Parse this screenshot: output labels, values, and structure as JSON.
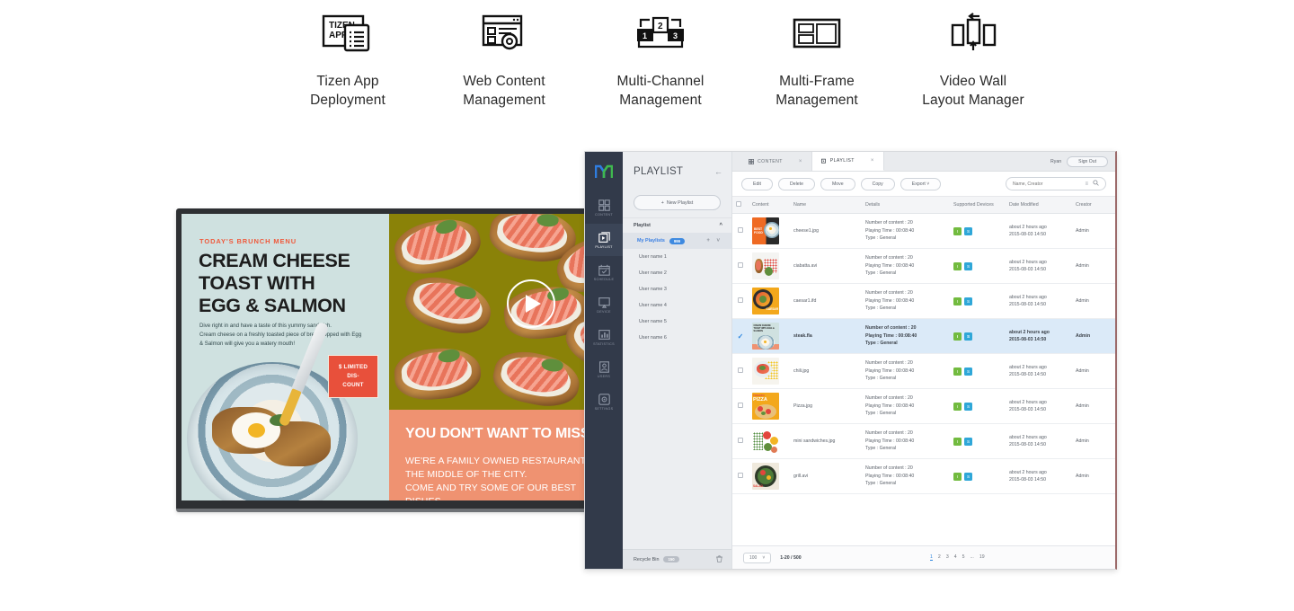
{
  "features": [
    {
      "icon": "tizen-app-icon",
      "label_line1": "Tizen App",
      "label_line2": "Deployment"
    },
    {
      "icon": "web-content-icon",
      "label_line1": "Web Content",
      "label_line2": "Management"
    },
    {
      "icon": "multi-channel-icon",
      "label_line1": "Multi-Channel",
      "label_line2": "Management"
    },
    {
      "icon": "multi-frame-icon",
      "label_line1": "Multi-Frame",
      "label_line2": "Management"
    },
    {
      "icon": "video-wall-icon",
      "label_line1": "Video Wall",
      "label_line2": "Layout Manager"
    }
  ],
  "display": {
    "kicker": "TODAY'S BRUNCH MENU",
    "title_line1": "CREAM CHEESE",
    "title_line2": "TOAST WITH",
    "title_line3": "EGG & SALMON",
    "body_line1": "Dive right in and have a taste of this yummy sandwich.",
    "body_line2": "Cream cheese on a freshly toasted piece of bread topped with Egg",
    "body_line3": "& Salmon will give you a watery mouth!",
    "discount_line1": "$ LIMITED",
    "discount_line2": "DIS-",
    "discount_line3": "COUNT",
    "promo_heading": "YOU DON'T WANT TO MISS",
    "promo_line1": "WE'RE A FAMILY OWNED RESTAURANT IN",
    "promo_line2": "THE MIDDLE OF THE CITY.",
    "promo_line3": "COME AND TRY SOME OF OUR BEST DISHES",
    "play_icon": "play-icon",
    "colors": {
      "menu_bg": "#cfe1e0",
      "accent": "#ef5a3c",
      "promo_bg": "#ef9271",
      "photo_bg": "#8a8208"
    }
  },
  "cms": {
    "logo": "magicinfo-logo",
    "rail": [
      {
        "id": "content",
        "icon": "grid-icon",
        "label": "CONTENT",
        "active": false
      },
      {
        "id": "playlist",
        "icon": "playlist-icon",
        "label": "PLAYLIST",
        "active": true
      },
      {
        "id": "schedule",
        "icon": "calendar-icon",
        "label": "SCHEDULE",
        "active": false
      },
      {
        "id": "device",
        "icon": "monitor-icon",
        "label": "DEVICE",
        "active": false
      },
      {
        "id": "statistics",
        "icon": "chart-icon",
        "label": "STATISTICS",
        "active": false
      },
      {
        "id": "users",
        "icon": "user-icon",
        "label": "USERS",
        "active": false
      },
      {
        "id": "settings",
        "icon": "gear-icon",
        "label": "SETTINGS",
        "active": false
      }
    ],
    "tree": {
      "title": "PLAYLIST",
      "collapse_icon": "arrow-left-icon",
      "new_button": "New Playlist",
      "section_label": "Playlist",
      "section_chevron": "chevron-up-icon",
      "selected": {
        "label": "My Playlists",
        "badge": "999"
      },
      "items": [
        {
          "label": "User name 1"
        },
        {
          "label": "User name 2"
        },
        {
          "label": "User name 3"
        },
        {
          "label": "User name 4"
        },
        {
          "label": "User name 5"
        },
        {
          "label": "User name 6"
        }
      ],
      "recycle": {
        "label": "Recycle Bin",
        "badge": "150",
        "icon": "trash-icon"
      }
    },
    "tabs": [
      {
        "label": "CONTENT",
        "icon": "grid-icon",
        "active": false,
        "close": "×"
      },
      {
        "label": "PLAYLIST",
        "icon": "playlist-icon",
        "active": true,
        "close": "×"
      }
    ],
    "account": {
      "user": "Ryan",
      "signout": "Sign Out"
    },
    "toolbar": {
      "buttons": [
        "Edit",
        "Delete",
        "Move",
        "Copy"
      ],
      "export": "Export",
      "export_chevron": "chevron-down-icon",
      "search_placeholder": "Name, Creator",
      "search_value": "",
      "filter_icon": "filter-icon",
      "search_icon": "search-icon"
    },
    "table": {
      "columns": [
        "Content",
        "Name",
        "Details",
        "Supported Devices",
        "Date Modified",
        "Creator"
      ],
      "rows": [
        {
          "name": "cheese1.jpg",
          "content_count": "Number of content : 20",
          "playing_time": "Playing Time : 00:08:40",
          "type": "Type : General",
          "devices": [
            "I",
            "S"
          ],
          "date_rel": "about 2 hours ago",
          "date_abs": "2015-08-03 14:50",
          "creator": "Admin",
          "selected": false,
          "thumb": "bestfood-orange"
        },
        {
          "name": "ciabatta.avi",
          "content_count": "Number of content : 20",
          "playing_time": "Playing Time : 00:08:40",
          "type": "Type : General",
          "devices": [
            "I",
            "S"
          ],
          "date_rel": "about 2 hours ago",
          "date_abs": "2015-08-03 14:50",
          "creator": "Admin",
          "selected": false,
          "thumb": "ciabatta-white"
        },
        {
          "name": "caesar1.ifd",
          "content_count": "Number of content : 20",
          "playing_time": "Playing Time : 00:08:40",
          "type": "Type : General",
          "devices": [
            "I",
            "S"
          ],
          "date_rel": "about 2 hours ago",
          "date_abs": "2015-08-03 14:50",
          "creator": "Admin",
          "selected": false,
          "thumb": "caesar-yellow"
        },
        {
          "name": "steak.fla",
          "content_count": "Number of content : 20",
          "playing_time": "Playing Time : 00:08:40",
          "type": "Type : General",
          "devices": [
            "I",
            "S"
          ],
          "date_rel": "about 2 hours ago",
          "date_abs": "2015-08-03 14:50",
          "creator": "Admin",
          "selected": true,
          "thumb": "cream-cheese-poster",
          "thumb_caption": "CREAM CHEESE TOAST WITH EGG & SALMON"
        },
        {
          "name": "chili.jpg",
          "content_count": "Number of content : 20",
          "playing_time": "Playing Time : 00:08:40",
          "type": "Type : General",
          "devices": [
            "I",
            "S"
          ],
          "date_rel": "about 2 hours ago",
          "date_abs": "2015-08-03 14:50",
          "creator": "Admin",
          "selected": false,
          "thumb": "chili-yellowdots"
        },
        {
          "name": "Pizza.jpg",
          "content_count": "Number of content : 20",
          "playing_time": "Playing Time : 00:08:40",
          "type": "Type : General",
          "devices": [
            "I",
            "S"
          ],
          "date_rel": "about 2 hours ago",
          "date_abs": "2015-08-03 14:50",
          "creator": "Admin",
          "selected": false,
          "thumb": "tomato-pizza"
        },
        {
          "name": "mini sandwiches.jpg",
          "content_count": "Number of content : 20",
          "playing_time": "Playing Time : 00:08:40",
          "type": "Type : General",
          "devices": [
            "I",
            "S"
          ],
          "date_rel": "about 2 hours ago",
          "date_abs": "2015-08-03 14:50",
          "creator": "Admin",
          "selected": false,
          "thumb": "mini-sandwiches"
        },
        {
          "name": "grill.avi",
          "content_count": "Number of content : 20",
          "playing_time": "Playing Time : 00:08:40",
          "type": "Type : General",
          "devices": [
            "I",
            "S"
          ],
          "date_rel": "about 2 hours ago",
          "date_abs": "2015-08-03 14:50",
          "creator": "Admin",
          "selected": false,
          "thumb": "salad-bowl"
        }
      ]
    },
    "pager": {
      "page_size": "100",
      "range": "1-20 / 500",
      "pages": [
        "1",
        "2",
        "3",
        "4",
        "5",
        "...",
        "19"
      ],
      "current": "1"
    },
    "colors": {
      "rail_bg": "#323a4a",
      "accent": "#2f88e0",
      "selected_row": "#dbeaf8",
      "dev_i": "#72bb3f",
      "dev_s": "#2fa7d8"
    }
  }
}
